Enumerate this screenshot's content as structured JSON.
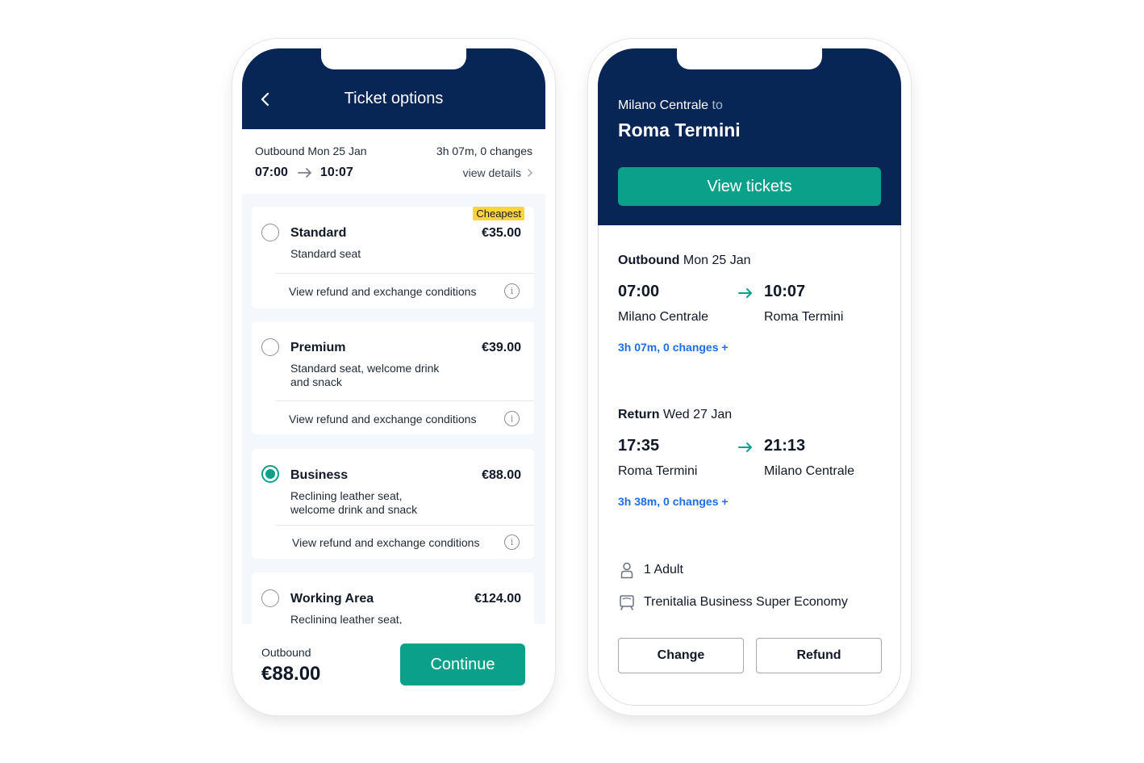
{
  "left_phone": {
    "title": "Ticket options",
    "journey": {
      "date": "Outbound Mon 25 Jan",
      "duration": "3h 07m, 0 changes",
      "depart": "07:00",
      "arrive": "10:07",
      "details_link": "view details"
    },
    "options": [
      {
        "name": "Standard",
        "price": "€35.00",
        "desc": "Standard seat",
        "badge": "Cheapest",
        "link": "View refund and exchange conditions",
        "selected": false
      },
      {
        "name": "Premium",
        "price": "€39.00",
        "desc": "Standard seat, welcome drink and snack",
        "link": "View refund and exchange conditions",
        "selected": false
      },
      {
        "name": "Business",
        "price": "€88.00",
        "desc": "Reclining leather seat, welcome drink and snack",
        "link": "View refund and exchange conditions",
        "selected": true
      },
      {
        "name": "Working Area",
        "price": "€124.00",
        "desc": "Reclining leather seat,",
        "selected": false
      }
    ],
    "bottom": {
      "label": "Outbound",
      "price": "€88.00",
      "continue": "Continue"
    }
  },
  "right_phone": {
    "from": "Milano Centrale",
    "to_word": "to",
    "destination": "Roma Termini",
    "view_tickets": "View tickets",
    "outbound": {
      "title_bold": "Outbound",
      "title_rest": "Mon 25 Jan",
      "depart_time": "07:00",
      "depart_station": "Milano Centrale",
      "arrive_time": "10:07",
      "arrive_station": "Roma Termini",
      "summary": "3h 07m, 0 changes +"
    },
    "return": {
      "title_bold": "Return",
      "title_rest": "Wed 27 Jan",
      "depart_time": "17:35",
      "depart_station": "Roma Termini",
      "arrive_time": "21:13",
      "arrive_station": "Milano Centrale",
      "summary": "3h 38m, 0 changes +"
    },
    "passengers": "1 Adult",
    "fare": "Trenitalia Business Super Economy",
    "change_button": "Change",
    "refund_button": "Refund"
  },
  "colors": {
    "navy": "#082655",
    "teal": "#0aa08a",
    "link_blue": "#1d6ee8",
    "badge_yellow": "#ffd43b",
    "options_bg": "#f4f8fc"
  },
  "icons": [
    "back-chevron-icon",
    "arrow-right-icon",
    "chevron-right-icon",
    "info-icon",
    "person-icon",
    "train-icon"
  ]
}
